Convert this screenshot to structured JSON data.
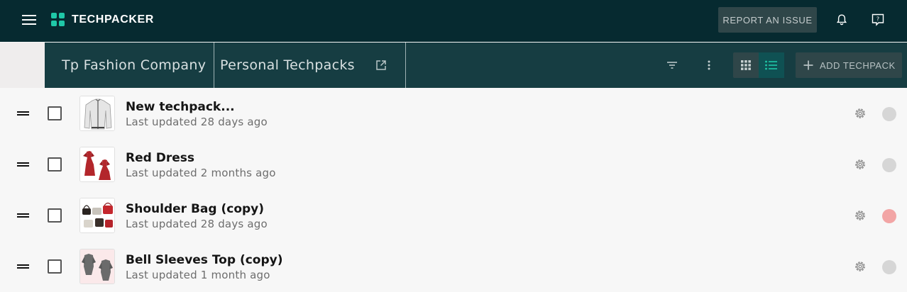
{
  "app": {
    "brand": "TECHPACKER",
    "report_label": "REPORT AN ISSUE",
    "accent": "#1fc8a8"
  },
  "breadcrumb": {
    "company": "Tp Fashion Company",
    "section": "Personal Techpacks"
  },
  "toolbar": {
    "add_label": "ADD TECHPACK",
    "active_view": "list"
  },
  "techpacks": [
    {
      "title": "New techpack...",
      "updated": "Last updated 28 days ago",
      "status_color": "#d6d6d6",
      "thumbnail": "jacket"
    },
    {
      "title": "Red Dress",
      "updated": "Last updated 2 months ago",
      "status_color": "#d6d6d6",
      "thumbnail": "dress"
    },
    {
      "title": "Shoulder Bag (copy)",
      "updated": "Last updated 28 days ago",
      "status_color": "#f2a5a5",
      "thumbnail": "bag"
    },
    {
      "title": "Bell Sleeves Top (copy)",
      "updated": "Last updated 1 month ago",
      "status_color": "#d6d6d6",
      "thumbnail": "top"
    }
  ]
}
